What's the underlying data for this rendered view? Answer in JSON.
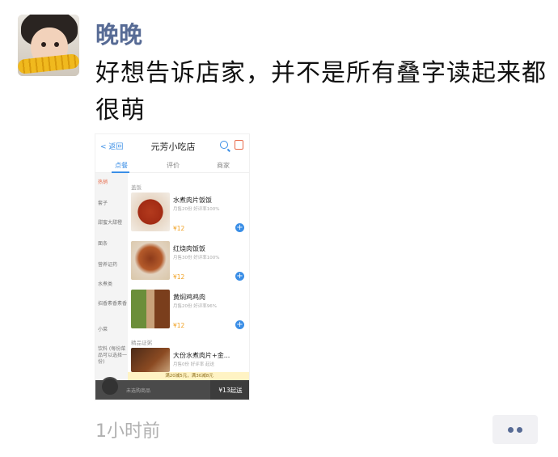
{
  "post": {
    "author": "晚晚",
    "message": "好想告诉店家，并不是所有叠字读起来都很萌",
    "time": "1小时前",
    "more_icon": "more-dots-icon"
  },
  "screenshot": {
    "back_label": "返回",
    "store_name": "元芳小吃店",
    "tabs": [
      "点餐",
      "评价",
      "商家"
    ],
    "sidebar": [
      "热销",
      "套子",
      "甜蜜大甜橙",
      "面条",
      "营养证药",
      "水煮类",
      "招香素香素香",
      "小菜",
      "饮料 (每份菜品可以选择一份)"
    ],
    "section_main": "盖饭",
    "section_extra": "精品证粥",
    "dishes": [
      {
        "name": "水煮肉片饭饭",
        "meta": "月售20份  好评率100%",
        "price": "¥12"
      },
      {
        "name": "红烧肉饭饭",
        "meta": "月售30份  好评率100%",
        "price": "¥12"
      },
      {
        "name": "黄焖鸡鸡肉",
        "meta": "月售20份  好评率96%",
        "price": "¥12"
      },
      {
        "name": "大份水煮肉片+金...",
        "meta": "月售0份  好评率  起送",
        "price": ""
      }
    ],
    "notice": "满20减5元，满30减8元",
    "cart_text": "未选购商品",
    "min_order": "¥13起送"
  }
}
